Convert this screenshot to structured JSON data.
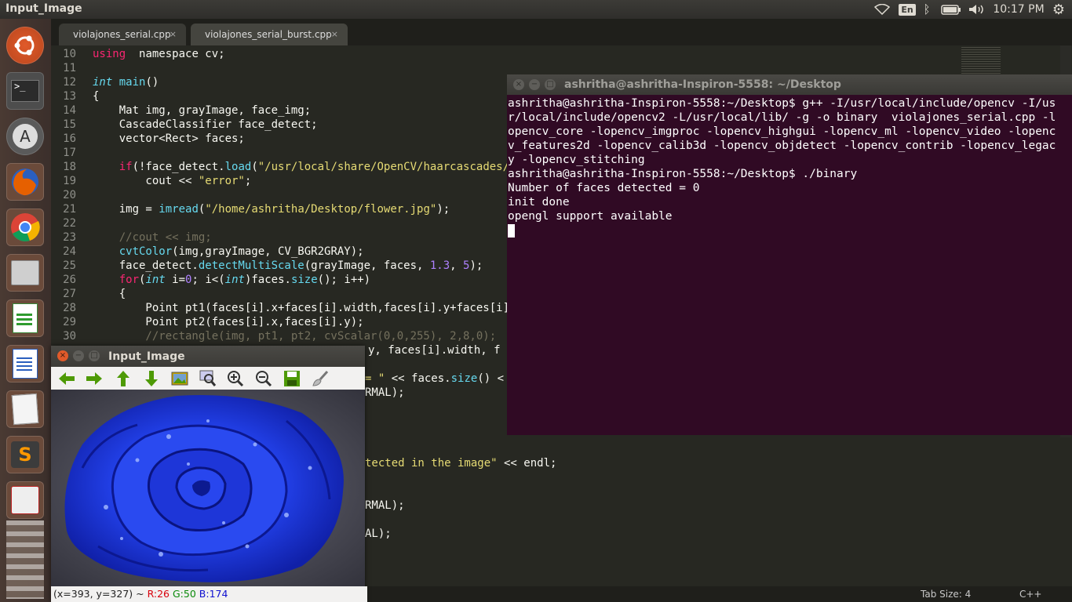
{
  "top_panel": {
    "title": "Input_Image",
    "keyboard_lang": "En",
    "clock": "10:17 PM"
  },
  "launcher": {
    "items": [
      "ubuntu-dash",
      "terminal",
      "software-updater",
      "firefox",
      "chrome",
      "files",
      "libreoffice-calc",
      "libreoffice-writer",
      "text-editor",
      "sublime-text",
      "evince-viewer"
    ]
  },
  "editor": {
    "tabs": [
      {
        "label": "violajones_serial.cpp",
        "close": "×"
      },
      {
        "label": "violajones_serial_burst.cpp",
        "close": "×"
      }
    ],
    "line_numbers": [
      "10",
      "11",
      "12",
      "13",
      "14",
      "15",
      "16",
      "17",
      "18",
      "19",
      "20",
      "21",
      "22",
      "23",
      "24",
      "25",
      "26",
      "27",
      "28",
      "29",
      "30"
    ],
    "code_lines": [
      [
        [
          "kw",
          "using"
        ],
        [
          "",
          "  namespace cv;"
        ]
      ],
      [],
      [
        [
          "ty",
          "int"
        ],
        [
          "",
          " "
        ],
        [
          "fn",
          "main"
        ],
        [
          "",
          "()"
        ]
      ],
      [
        [
          "",
          "{"
        ]
      ],
      [
        [
          "",
          "    Mat img, grayImage, face_img;"
        ]
      ],
      [
        [
          "",
          "    CascadeClassifier face_detect;"
        ]
      ],
      [
        [
          "",
          "    vector<Rect> faces;"
        ]
      ],
      [],
      [
        [
          "",
          "    "
        ],
        [
          "kw",
          "if"
        ],
        [
          "",
          "(!face_detect."
        ],
        [
          "fn",
          "load"
        ],
        [
          "",
          "("
        ],
        [
          "st",
          "\"/usr/local/share/OpenCV/haarcascades/"
        ]
      ],
      [
        [
          "",
          "        cout << "
        ],
        [
          "st",
          "\"error\""
        ],
        [
          "",
          ";"
        ]
      ],
      [],
      [
        [
          "",
          "    img = "
        ],
        [
          "fn",
          "imread"
        ],
        [
          "",
          "("
        ],
        [
          "st",
          "\"/home/ashritha/Desktop/flower.jpg\""
        ],
        [
          "",
          ");"
        ]
      ],
      [],
      [
        [
          "cm",
          "    //cout << img;"
        ]
      ],
      [
        [
          "",
          "    "
        ],
        [
          "fn",
          "cvtColor"
        ],
        [
          "",
          "(img,grayImage, CV_BGR2GRAY);"
        ]
      ],
      [
        [
          "",
          "    face_detect."
        ],
        [
          "fn",
          "detectMultiScale"
        ],
        [
          "",
          "(grayImage, faces, "
        ],
        [
          "nm",
          "1.3"
        ],
        [
          "",
          ", "
        ],
        [
          "nm",
          "5"
        ],
        [
          "",
          ");"
        ]
      ],
      [
        [
          "",
          "    "
        ],
        [
          "kw",
          "for"
        ],
        [
          "",
          "("
        ],
        [
          "ty",
          "int"
        ],
        [
          "",
          " i="
        ],
        [
          "nm",
          "0"
        ],
        [
          "",
          "; i<("
        ],
        [
          "ty",
          "int"
        ],
        [
          "",
          ")faces."
        ],
        [
          "fn",
          "size"
        ],
        [
          "",
          "(); i++)"
        ]
      ],
      [
        [
          "",
          "    {"
        ]
      ],
      [
        [
          "",
          "        Point pt1(faces[i].x+faces[i].width,faces[i].y+faces[i].height);"
        ]
      ],
      [
        [
          "",
          "        Point pt2(faces[i].x,faces[i].y);"
        ]
      ],
      [
        [
          "cm",
          "        //rectangle(img, pt1, pt2, cvScalar(0,0,255), 2,8,0);"
        ]
      ]
    ],
    "partial_lines": [
      [
        [
          "",
          "y, faces[i].width, f"
        ]
      ],
      [
        [
          "st",
          "= \""
        ],
        [
          "",
          " << faces."
        ],
        [
          "fn",
          "size"
        ],
        [
          "",
          "() <"
        ]
      ],
      [
        [
          "",
          "RMAL);"
        ]
      ],
      [
        [
          "st",
          "tected in the image\""
        ],
        [
          "",
          " << endl;"
        ]
      ],
      [
        [
          "",
          "RMAL);"
        ]
      ],
      [
        [
          "",
          "AL);"
        ]
      ]
    ],
    "status_tab_size": "Tab Size: 4",
    "status_syntax": "C++"
  },
  "terminal": {
    "title": "ashritha@ashritha-Inspiron-5558: ~/Desktop",
    "lines": [
      "ashritha@ashritha-Inspiron-5558:~/Desktop$ g++ -I/usr/local/include/opencv -I/us",
      "r/local/include/opencv2 -L/usr/local/lib/ -g -o binary  violajones_serial.cpp -l",
      "opencv_core -lopencv_imgproc -lopencv_highgui -lopencv_ml -lopencv_video -lopenc",
      "v_features2d -lopencv_calib3d -lopencv_objdetect -lopencv_contrib -lopencv_legac",
      "y -lopencv_stitching",
      "ashritha@ashritha-Inspiron-5558:~/Desktop$ ./binary",
      "Number of faces detected = 0",
      "init done",
      "opengl support available"
    ]
  },
  "viewer": {
    "title": "Input_Image",
    "toolbar": [
      "arrow-left-icon",
      "arrow-right-icon",
      "arrow-up-icon",
      "arrow-down-icon",
      "picture-icon",
      "zoom-fit-icon",
      "zoom-in-icon",
      "zoom-out-icon",
      "save-icon",
      "brush-icon"
    ],
    "status": {
      "coords": "(x=393, y=327) ~ ",
      "r": "R:26",
      "g": "G:50",
      "b": "B:174"
    },
    "colors": {
      "r": "#d8000c",
      "g": "#0a8a0a",
      "b": "#1010d0"
    }
  }
}
